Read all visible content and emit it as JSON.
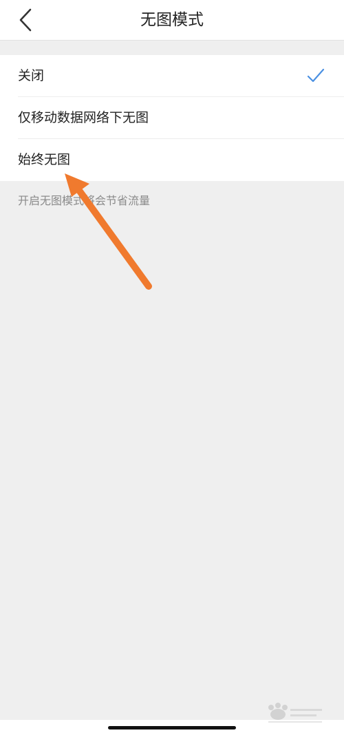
{
  "header": {
    "title": "无图模式",
    "back_icon": "chevron-left-icon"
  },
  "options": [
    {
      "label": "关闭",
      "selected": true
    },
    {
      "label": "仅移动数据网络下无图",
      "selected": false
    },
    {
      "label": "始终无图",
      "selected": false
    }
  ],
  "hint": "开启无图模式将会节省流量",
  "colors": {
    "check": "#4a90e2",
    "arrow": "#f07a2e",
    "background": "#efefef"
  }
}
